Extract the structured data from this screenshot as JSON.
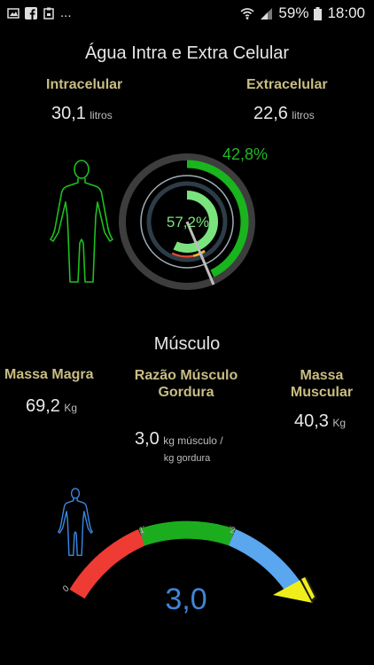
{
  "status": {
    "overflow": "...",
    "battery": "59%",
    "time": "18:00"
  },
  "water": {
    "title": "Água Intra e Extra Celular",
    "intra_label": "Intracelular",
    "intra_value": "30,1",
    "intra_unit": "litros",
    "extra_label": "Extracelular",
    "extra_value": "22,6",
    "extra_unit": "litros",
    "outer_percent": "42,8%",
    "inner_percent": "57,2%",
    "outer_fraction": 0.428,
    "inner_fraction": 0.572,
    "outer_color": "#19b41e",
    "inner_color": "#7be37e"
  },
  "muscle": {
    "title": "Músculo",
    "lean_label": "Massa Magra",
    "lean_value": "69,2",
    "lean_unit": "Kg",
    "ratio_label": "Razão Músculo Gordura",
    "ratio_value": "3,0",
    "ratio_unit_1": "kg músculo /",
    "ratio_unit_2": "kg gordura",
    "mass_label": "Massa Muscular",
    "mass_value": "40,3",
    "mass_unit": "Kg"
  },
  "gauge": {
    "value": "3,0",
    "needle_value": 3.0,
    "ticks": [
      "0",
      "1",
      "2"
    ],
    "colors": [
      "#ee3b34",
      "#1cad1f",
      "#5aa6ef"
    ],
    "value_color": "#3f86d6"
  }
}
